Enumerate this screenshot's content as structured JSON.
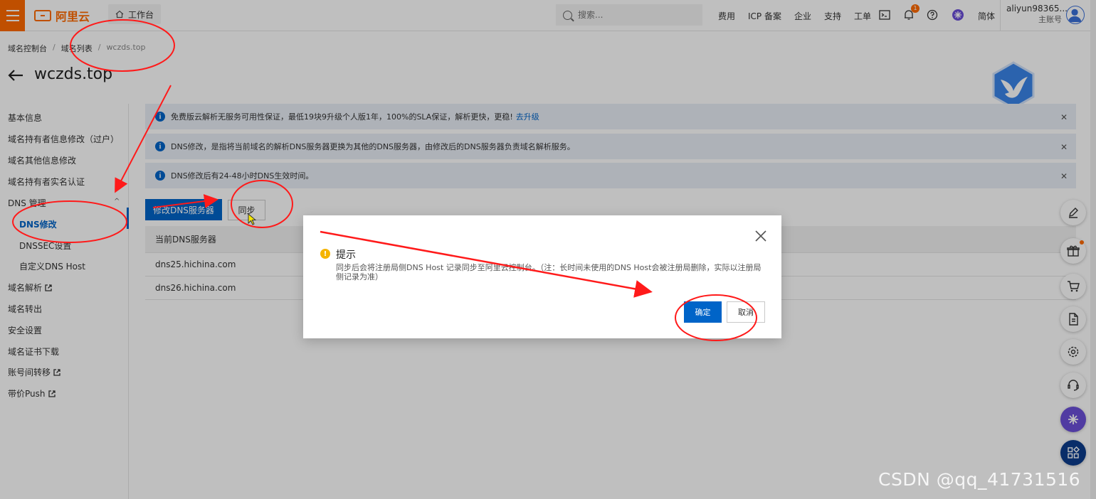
{
  "brand": {
    "logo_text": "阿里云",
    "accent": "#ff6a00",
    "primary": "#0064c8"
  },
  "header": {
    "workbench_label": "工作台",
    "search_placeholder": "搜索...",
    "links": [
      "费用",
      "ICP 备案",
      "企业",
      "支持",
      "工单"
    ],
    "notification_count": "1",
    "language": "简体",
    "account_name": "aliyun98365...",
    "account_role": "主账号"
  },
  "breadcrumb": {
    "items": [
      "域名控制台",
      "域名列表"
    ],
    "current": "wczds.top"
  },
  "page": {
    "title": "wczds.top"
  },
  "sidebar": {
    "items": [
      {
        "label": "基本信息"
      },
      {
        "label": "域名持有者信息修改（过户）"
      },
      {
        "label": "域名其他信息修改"
      },
      {
        "label": "域名持有者实名认证"
      },
      {
        "label": "DNS 管理"
      },
      {
        "label": "DNS修改"
      },
      {
        "label": "DNSSEC设置"
      },
      {
        "label": "自定义DNS Host"
      },
      {
        "label": "域名解析"
      },
      {
        "label": "域名转出"
      },
      {
        "label": "安全设置"
      },
      {
        "label": "域名证书下载"
      },
      {
        "label": "账号间转移"
      },
      {
        "label": "带价Push"
      }
    ]
  },
  "alerts": [
    {
      "text": "免费版云解析无服务可用性保证，最低19块9升级个人版1年，100%的SLA保证，解析更快，更稳!",
      "link": "去升级"
    },
    {
      "text": "DNS修改，是指将当前域名的解析DNS服务器更换为其他的DNS服务器，由修改后的DNS服务器负责域名解析服务。"
    },
    {
      "text": "DNS修改后有24-48小时DNS生效时间。"
    }
  ],
  "actions": {
    "modify_dns": "修改DNS服务器",
    "sync": "同步"
  },
  "table": {
    "header": "当前DNS服务器",
    "rows": [
      "dns25.hichina.com",
      "dns26.hichina.com"
    ]
  },
  "dialog": {
    "title": "提示",
    "body": "同步后会将注册局侧DNS Host 记录同步至阿里云控制台。（注：长时间未使用的DNS Host会被注册局删除，实际以注册局侧记录为准）",
    "ok_label": "确定",
    "cancel_label": "取消"
  },
  "watermark": "CSDN @qq_41731516",
  "icons": {
    "header": [
      "home-icon",
      "search-icon",
      "terminal-icon",
      "bell-icon",
      "help-icon",
      "ai-assistant-icon",
      "avatar"
    ],
    "tools": [
      "edit-icon",
      "gift-icon",
      "cart-icon",
      "document-icon",
      "settings-icon",
      "headset-icon",
      "ai-assistant-icon",
      "apps-icon"
    ]
  }
}
